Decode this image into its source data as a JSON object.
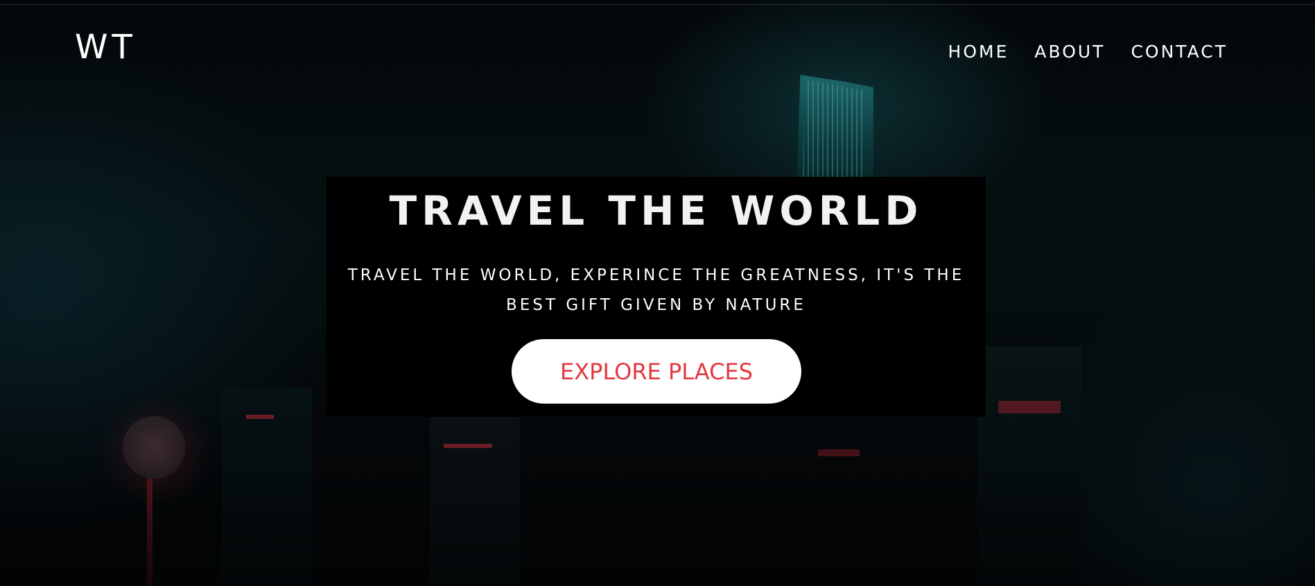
{
  "header": {
    "logo": "WT",
    "nav": [
      {
        "label": "HOME"
      },
      {
        "label": "ABOUT"
      },
      {
        "label": "CONTACT"
      }
    ]
  },
  "hero": {
    "title": "TRAVEL THE WORLD",
    "subtitle_line1": "TRAVEL THE WORLD, EXPERINCE THE GREATNESS, IT'S THE",
    "subtitle_line2": "BEST GIFT GIVEN BY NATURE",
    "cta_label": "EXPLORE PLACES"
  },
  "colors": {
    "background": "#020304",
    "panel": "#000000",
    "text": "#ffffff",
    "cta_background": "#ffffff",
    "cta_text": "#e2383f"
  }
}
